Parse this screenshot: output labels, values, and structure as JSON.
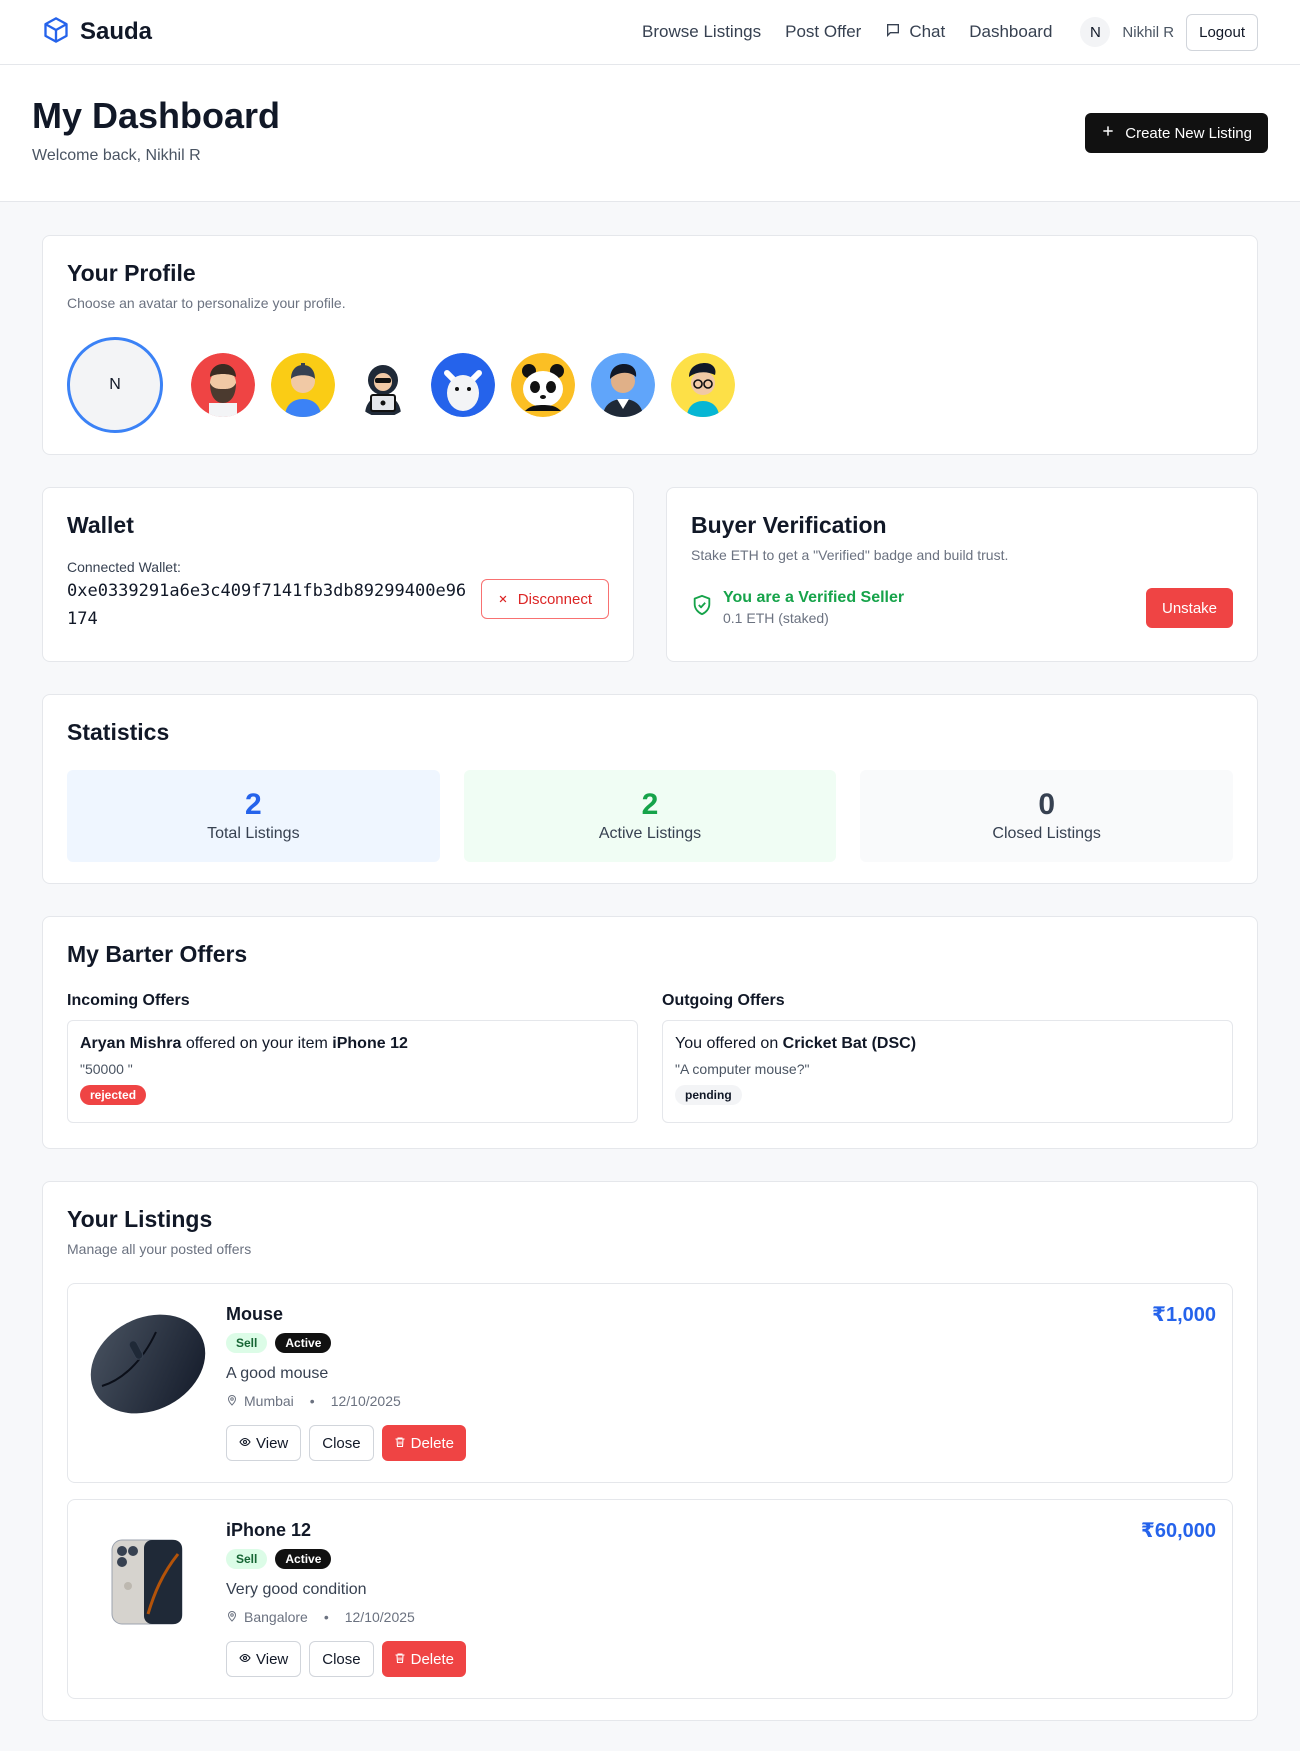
{
  "nav": {
    "brand": "Sauda",
    "links": [
      "Browse Listings",
      "Post Offer",
      "Chat",
      "Dashboard"
    ],
    "user_initial": "N",
    "user_name": "Nikhil R",
    "logout": "Logout"
  },
  "header": {
    "title": "My Dashboard",
    "subtitle": "Welcome back, Nikhil R",
    "create_button": "Create New Listing"
  },
  "profile": {
    "title": "Your Profile",
    "subtitle": "Choose an avatar to personalize your profile.",
    "current_initial": "N"
  },
  "wallet": {
    "title": "Wallet",
    "label": "Connected Wallet:",
    "address": "0xe0339291a6e3c409f7141fb3db89299400e96174",
    "disconnect": "Disconnect"
  },
  "verification": {
    "title": "Buyer Verification",
    "subtitle": "Stake ETH to get a \"Verified\" badge and build trust.",
    "status": "You are a Verified Seller",
    "staked": "0.1 ETH (staked)",
    "unstake": "Unstake"
  },
  "stats": {
    "title": "Statistics",
    "items": [
      {
        "value": "2",
        "label": "Total Listings",
        "color": "#2563eb",
        "bg": "#eff6ff"
      },
      {
        "value": "2",
        "label": "Active Listings",
        "color": "#16a34a",
        "bg": "#f0fdf4"
      },
      {
        "value": "0",
        "label": "Closed Listings",
        "color": "#374151",
        "bg": "#f9fafb"
      }
    ]
  },
  "offers": {
    "title": "My Barter Offers",
    "incoming_title": "Incoming Offers",
    "outgoing_title": "Outgoing Offers",
    "incoming": {
      "who": "Aryan Mishra",
      "mid": " offered on your item ",
      "item": "iPhone 12",
      "quote": "\"50000 \"",
      "status": "rejected"
    },
    "outgoing": {
      "pre": "You offered on ",
      "item": "Cricket Bat (DSC)",
      "quote": "\"A computer mouse?\"",
      "status": "pending"
    }
  },
  "listings": {
    "title": "Your Listings",
    "subtitle": "Manage all your posted offers",
    "items": [
      {
        "title": "Mouse",
        "type": "Sell",
        "status": "Active",
        "desc": "A good mouse",
        "location": "Mumbai",
        "date": "12/10/2025",
        "price": "₹1,000",
        "view": "View",
        "close": "Close",
        "delete": "Delete"
      },
      {
        "title": "iPhone 12",
        "type": "Sell",
        "status": "Active",
        "desc": "Very good condition",
        "location": "Bangalore",
        "date": "12/10/2025",
        "price": "₹60,000",
        "view": "View",
        "close": "Close",
        "delete": "Delete"
      }
    ]
  },
  "colors": {
    "accent": "#2563eb",
    "success": "#16a34a",
    "danger": "#ef4444"
  }
}
